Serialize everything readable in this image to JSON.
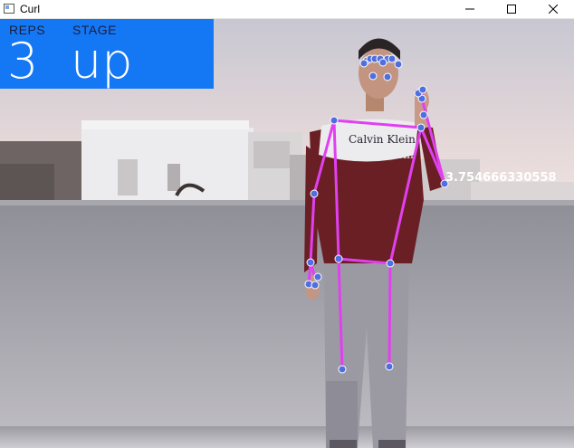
{
  "window": {
    "title": "Curl",
    "controls": {
      "minimize": "minimize-icon",
      "maximize": "maximize-icon",
      "close": "close-icon"
    }
  },
  "overlay": {
    "reps_label": "REPS",
    "reps_value": "3",
    "stage_label": "STAGE",
    "stage_value": "up",
    "panel_color": "#1478f5",
    "angle_text": "3.754666330558"
  },
  "colors": {
    "skeleton_line": "#e040f0",
    "landmark": "#4f6fe0"
  }
}
